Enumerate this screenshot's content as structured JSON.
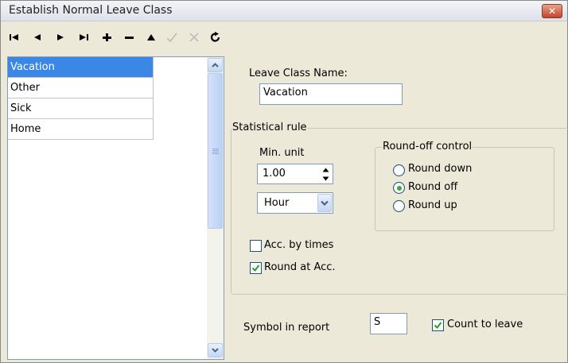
{
  "window": {
    "title": "Establish Normal Leave Class",
    "close_glyph": "✕"
  },
  "toolbar": {
    "buttons": [
      "first-record-icon",
      "prev-record-icon",
      "next-record-icon",
      "last-record-icon",
      "add-record-icon",
      "delete-record-icon",
      "edit-record-icon",
      "post-record-icon",
      "cancel-record-icon",
      "refresh-icon"
    ]
  },
  "list": {
    "items": [
      "Vacation",
      "Other",
      "Sick",
      "Home"
    ],
    "selected": "Vacation"
  },
  "form": {
    "name_label": "Leave Class Name:",
    "name_value": "Vacation",
    "statistical_rule": {
      "caption": "Statistical rule",
      "min_unit_label": "Min. unit",
      "min_unit_value": "1.00",
      "unit_value": "Hour",
      "roundoff": {
        "caption": "Round-off control",
        "options": [
          "Round down",
          "Round off",
          "Round up"
        ],
        "selected": "Round off"
      },
      "acc_by_times": {
        "label": "Acc. by times",
        "checked": false
      },
      "round_at_acc": {
        "label": "Round at Acc.",
        "checked": true
      }
    },
    "symbol_label": "Symbol in report",
    "symbol_value": "S",
    "count_to_leave": {
      "label": "Count to leave",
      "checked": true
    }
  },
  "colors": {
    "selection": "#3b87e6",
    "window_bg": "#ece9d8",
    "check": "#21a121"
  }
}
